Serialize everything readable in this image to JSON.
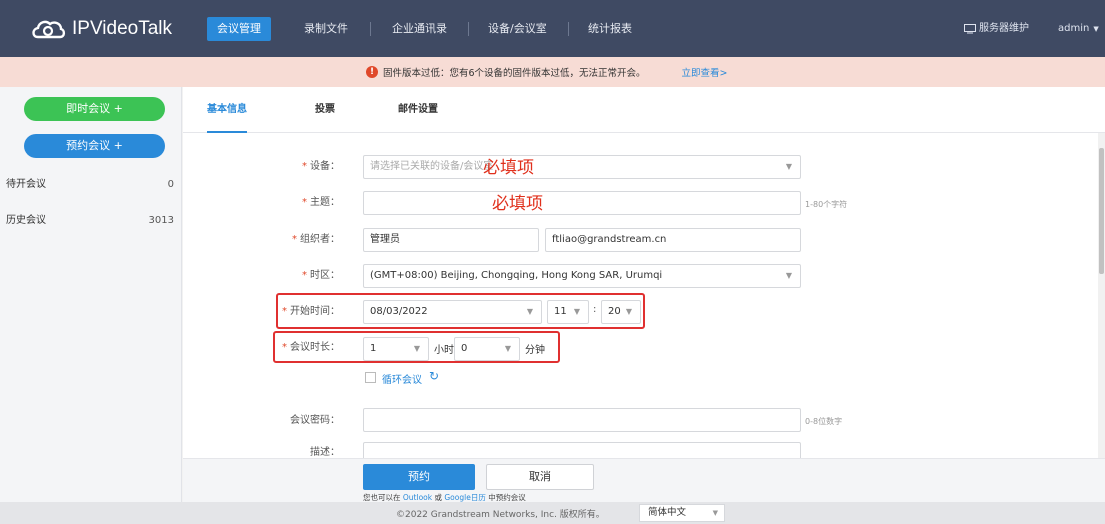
{
  "app": {
    "logo_text": "IPVideoTalk"
  },
  "topnav": {
    "items": [
      {
        "label": "会议管理"
      },
      {
        "label": "录制文件"
      },
      {
        "label": "企业通讯录"
      },
      {
        "label": "设备/会议室"
      },
      {
        "label": "统计报表"
      }
    ],
    "server_maint": "服务器维护",
    "user": "admin"
  },
  "alert": {
    "text": "固件版本过低：您有6个设备的固件版本过低，无法正常开会。",
    "link": "立即查看>"
  },
  "sidebar": {
    "instant_meeting": "即时会议 +",
    "schedule_meeting": "预约会议 +",
    "items": [
      {
        "label": "待开会议",
        "count": "0"
      },
      {
        "label": "历史会议",
        "count": "3013"
      }
    ]
  },
  "tabs": [
    {
      "label": "基本信息"
    },
    {
      "label": "投票"
    },
    {
      "label": "邮件设置"
    }
  ],
  "form": {
    "device": {
      "label": "设备：",
      "placeholder": "请选择已关联的设备/会议室"
    },
    "subject": {
      "label": "主题：",
      "value": "",
      "hint": "1-80个字符"
    },
    "organizer": {
      "label": "组织者：",
      "name": "管理员",
      "email": "ftliao@grandstream.cn"
    },
    "timezone": {
      "label": "时区：",
      "value": "(GMT+08:00) Beijing, Chongqing, Hong Kong SAR, Urumqi"
    },
    "start_time": {
      "label": "开始时间：",
      "date": "08/03/2022",
      "hour": "11",
      "separator": ":",
      "minute": "20"
    },
    "duration": {
      "label": "会议时长：",
      "hours": "1",
      "hours_unit": "小时",
      "minutes": "0",
      "minutes_unit": "分钟"
    },
    "recurring": {
      "label": "循环会议"
    },
    "password": {
      "label": "会议密码：",
      "value": "",
      "hint": "0-8位数字"
    },
    "description": {
      "label": "描述："
    }
  },
  "annotations": {
    "required_1": "必填项",
    "required_2": "必填项"
  },
  "actions": {
    "submit": "预约",
    "cancel": "取消",
    "note_prefix": "您也可以在",
    "outlook": "Outlook",
    "or": "或",
    "google": "Google日历",
    "note_suffix": "中预约会议"
  },
  "footer": {
    "copyright": "©2022 Grandstream Networks, Inc. 版权所有。",
    "language": "简体中文"
  },
  "colors": {
    "nav_bg": "#3f4a63",
    "accent": "#2a8ad9",
    "green": "#3cc355",
    "alert_bg": "#f7dcd5",
    "required_red": "#e0482a"
  }
}
